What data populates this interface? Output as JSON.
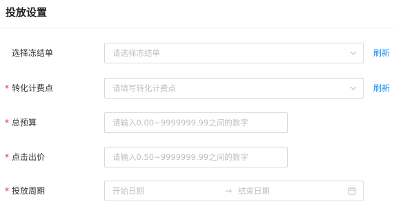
{
  "section": {
    "title": "投放设置"
  },
  "form": {
    "freeze_order": {
      "label": "选择冻结单",
      "required": false,
      "placeholder": "请选择冻结单",
      "refresh_label": "刷新"
    },
    "conversion_point": {
      "label": "转化计费点",
      "required": true,
      "placeholder": "请填写转化计费点",
      "refresh_label": "刷新"
    },
    "total_budget": {
      "label": "总预算",
      "required": true,
      "placeholder": "请输入0.00~9999999.99之间的数字"
    },
    "click_bid": {
      "label": "点击出价",
      "required": true,
      "placeholder": "请输入0.50~9999999.99之间的数字"
    },
    "delivery_period": {
      "label": "投放周期",
      "required": true,
      "start_placeholder": "开始日期",
      "separator": "→",
      "end_placeholder": "结束日期"
    },
    "required_mark": "*"
  },
  "icons": {
    "select_arrow": "chevron-down-icon",
    "date_picker": "calendar-icon"
  },
  "colors": {
    "link": "#1890ff",
    "required": "#f5222d",
    "placeholder": "#bfbfbf",
    "border": "#d9d9d9"
  }
}
